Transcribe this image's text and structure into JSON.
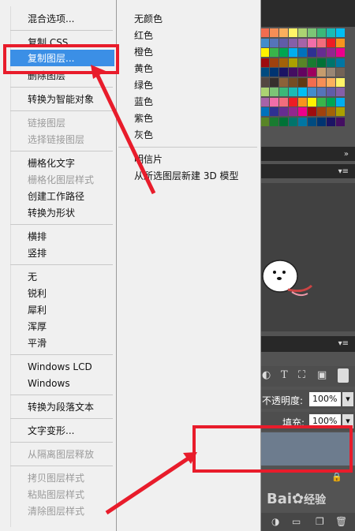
{
  "menu": {
    "items": [
      {
        "label": "混合选项...",
        "disabled": false
      },
      {
        "label": "复制 CSS",
        "disabled": false
      },
      {
        "label": "复制图层...",
        "disabled": false,
        "highlighted": true
      },
      {
        "label": "删除图层",
        "disabled": false
      },
      {
        "label": "转换为智能对象",
        "disabled": false
      },
      {
        "label": "链接图层",
        "disabled": true
      },
      {
        "label": "选择链接图层",
        "disabled": true
      },
      {
        "label": "栅格化文字",
        "disabled": false
      },
      {
        "label": "栅格化图层样式",
        "disabled": true
      },
      {
        "label": "创建工作路径",
        "disabled": false
      },
      {
        "label": "转换为形状",
        "disabled": false
      },
      {
        "label": "横排",
        "disabled": false
      },
      {
        "label": "竖排",
        "disabled": false
      },
      {
        "label": "无",
        "disabled": false
      },
      {
        "label": "锐利",
        "disabled": false
      },
      {
        "label": "犀利",
        "disabled": false
      },
      {
        "label": "浑厚",
        "disabled": false
      },
      {
        "label": "平滑",
        "disabled": false
      },
      {
        "label": "Windows LCD",
        "disabled": false
      },
      {
        "label": "Windows",
        "disabled": false
      },
      {
        "label": "转换为段落文本",
        "disabled": false
      },
      {
        "label": "文字变形...",
        "disabled": false
      },
      {
        "label": "从隔离图层释放",
        "disabled": true
      },
      {
        "label": "拷贝图层样式",
        "disabled": true
      },
      {
        "label": "粘贴图层样式",
        "disabled": true
      },
      {
        "label": "清除图层样式",
        "disabled": true
      }
    ]
  },
  "submenu": {
    "items": [
      "无颜色",
      "红色",
      "橙色",
      "黄色",
      "绿色",
      "蓝色",
      "紫色",
      "灰色",
      "明信片",
      "从所选图层新建 3D 模型"
    ]
  },
  "layers_panel": {
    "opacity_label": "不透明度:",
    "opacity_value": "100%",
    "fill_label": "填充:",
    "fill_value": "100%"
  },
  "watermark": {
    "brand": "Bai",
    "suffix": "经验"
  },
  "colors": {
    "highlight": "#3b8fe6",
    "annotation_red": "#e81c2b",
    "layer_selected": "#6d7c8e"
  }
}
